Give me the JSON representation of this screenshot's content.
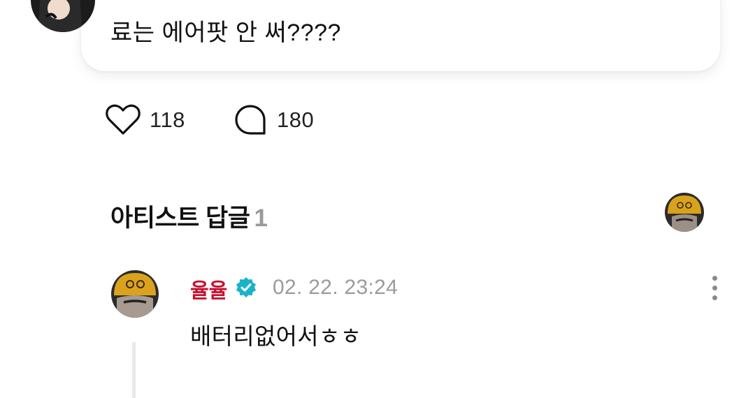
{
  "post": {
    "text": "료는 에어팟 안 써????",
    "likes": "118",
    "comments": "180"
  },
  "artist_replies": {
    "title": "아티스트 답글",
    "count": "1"
  },
  "reply": {
    "author": "율율",
    "timestamp": "02. 22. 23:24",
    "text": "배터리없어서ㅎㅎ"
  },
  "icons": {
    "like": "heart-outline-icon",
    "comment": "speech-bubble-icon",
    "verified": "verified-badge-icon",
    "more": "more-vertical-icon"
  },
  "colors": {
    "author_name": "#c8102e",
    "verified_badge": "#1ab3c9",
    "muted_text": "#9b9b9b"
  }
}
